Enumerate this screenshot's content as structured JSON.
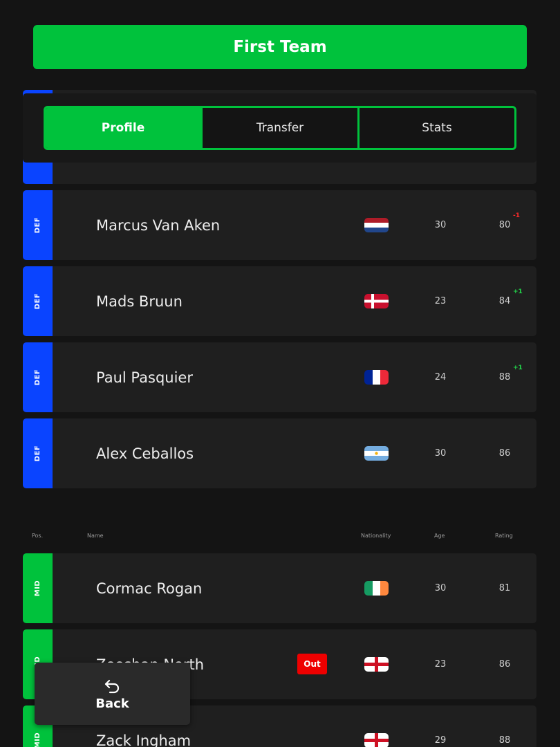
{
  "header": {
    "title": "First Team"
  },
  "tabs": [
    {
      "label": "Profile",
      "active": true
    },
    {
      "label": "Transfer",
      "active": false
    },
    {
      "label": "Stats",
      "active": false
    }
  ],
  "columns": {
    "pos": "Pos.",
    "name": "Name",
    "nationality": "Nationality",
    "age": "Age",
    "rating": "Rating"
  },
  "defenders": [
    {
      "pos": "DEF",
      "name": "Marcus Van Aken",
      "flag": "netherlands-flag-icon",
      "age": "30",
      "rating": "80",
      "delta": "-1",
      "delta_type": "neg"
    },
    {
      "pos": "DEF",
      "name": "Mads Bruun",
      "flag": "denmark-flag-icon",
      "age": "23",
      "rating": "84",
      "delta": "+1",
      "delta_type": "pos"
    },
    {
      "pos": "DEF",
      "name": "Paul Pasquier",
      "flag": "france-flag-icon",
      "age": "24",
      "rating": "88",
      "delta": "+1",
      "delta_type": "pos"
    },
    {
      "pos": "DEF",
      "name": "Alex Ceballos",
      "flag": "argentina-flag-icon",
      "age": "30",
      "rating": "86"
    }
  ],
  "midfielders": [
    {
      "pos": "MID",
      "name": "Cormac Rogan",
      "flag": "ireland-flag-icon",
      "age": "30",
      "rating": "81"
    },
    {
      "pos": "MID",
      "name": "Zeeshan North",
      "flag": "england-flag-icon",
      "age": "23",
      "rating": "86",
      "badge": "Out"
    },
    {
      "pos": "MID",
      "name": "Zack Ingham",
      "flag": "england-flag-icon",
      "age": "29",
      "rating": "88"
    }
  ],
  "back_button": {
    "label": "Back",
    "icon": "undo-arrow-icon"
  },
  "colors": {
    "accent_green": "#00c23c",
    "def_blue": "#0a44ff",
    "row_bg": "#1f1f1f",
    "page_bg": "#141414",
    "out_red": "#ee0000"
  }
}
